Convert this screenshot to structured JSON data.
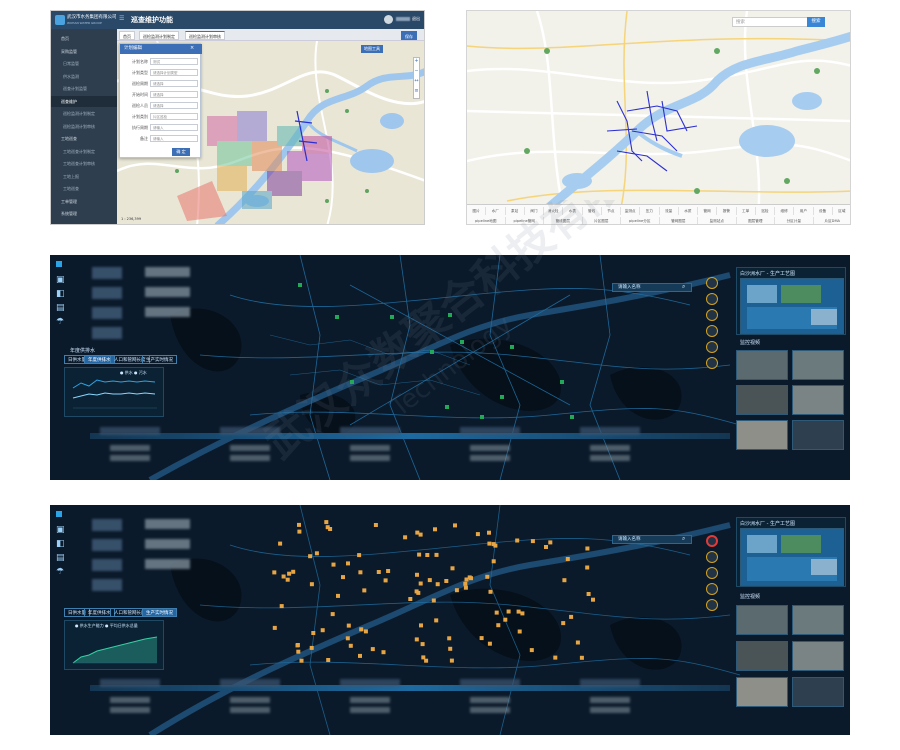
{
  "admin": {
    "org_name": "武汉市水务集团有限公司",
    "module_title": "巡查维护功能",
    "user_actions": "退出",
    "top_button": "保存",
    "menu": [
      {
        "label": "首页",
        "sub": false
      },
      {
        "label": "采购监管",
        "sub": false
      },
      {
        "label": "日常监管",
        "sub": true
      },
      {
        "label": "供水监测",
        "sub": true
      },
      {
        "label": "巡查计划监管",
        "sub": true
      },
      {
        "label": "巡查维护",
        "sub": false,
        "active": true
      },
      {
        "label": "巡检监测计划制定",
        "sub": true
      },
      {
        "label": "巡检监测计划审核",
        "sub": true
      },
      {
        "label": "工地巡查",
        "sub": false
      },
      {
        "label": "工地巡查计划制定",
        "sub": true
      },
      {
        "label": "工地巡查计划审核",
        "sub": true
      },
      {
        "label": "工地上报",
        "sub": true
      },
      {
        "label": "工地巡查",
        "sub": true
      },
      {
        "label": "工单管理",
        "sub": false
      },
      {
        "label": "系统管理",
        "sub": false
      }
    ],
    "tabs": [
      "首页",
      "巡检监测计划制定",
      "巡检监测计划审核"
    ],
    "form": {
      "title": "计划编辑",
      "fields": [
        {
          "label": "计划名称",
          "value": "测试"
        },
        {
          "label": "计划类型",
          "value": "请选择计划类型"
        },
        {
          "label": "巡检周期",
          "value": "请选择"
        },
        {
          "label": "开始时间",
          "value": "请选择"
        },
        {
          "label": "巡检人员",
          "value": "请选择"
        },
        {
          "label": "计划类别",
          "value": "片区巡检"
        },
        {
          "label": "执行周期",
          "value": "请输入"
        },
        {
          "label": "备注",
          "value": "请输入"
        }
      ],
      "submit": "确 定"
    },
    "map_button": "地图工具",
    "scale": "1 : 236,399"
  },
  "gis": {
    "search_placeholder": "搜索",
    "search_button": "搜索",
    "layers": [
      "图片",
      "水厂",
      "泵站",
      "阀门",
      "消火栓",
      "水表",
      "管线",
      "节点",
      "监测点",
      "压力",
      "流量",
      "水质",
      "管网",
      "报警",
      "工单",
      "巡检",
      "维修",
      "用户",
      "设备",
      "区域"
    ],
    "layers2": [
      "pipeline地图",
      "pipeline管网",
      "管线图层",
      "片区图层",
      "pipeline分区",
      "管网图层",
      "监测站点",
      "图层管理",
      "分区计量",
      "片区DMA"
    ]
  },
  "dashboard1": {
    "tab_title": "年度供排水",
    "tabs": [
      "日供水量",
      "年度供排水",
      "人口和管网长度",
      "生产实时情况"
    ],
    "legend": [
      "供水",
      "污水"
    ],
    "search": "请输入名称",
    "right_title": "白沙洲水厂 - 生产工艺图",
    "video_title": "监控视频",
    "side_labels": [
      "类型",
      "水厂",
      "泵站",
      "管网",
      "水质",
      "监测"
    ]
  },
  "dashboard2": {
    "tabs": [
      "日供水量",
      "年度供排水",
      "人口和管网长度",
      "生产实时情况"
    ],
    "legend": [
      "供水生产能力",
      "平均日供水总量"
    ],
    "search": "请输入名称",
    "right_title": "白沙洲水厂 - 生产工艺图",
    "video_title": "监控视频"
  },
  "watermark": {
    "company": "武汉众数聚合科技有限公司",
    "english": "Technology"
  },
  "colors": {
    "admin_bar": "#2a4868",
    "dashboard_bg": "#0c1c2c",
    "station": "#e8a544",
    "accent": "#2aa4e6"
  }
}
